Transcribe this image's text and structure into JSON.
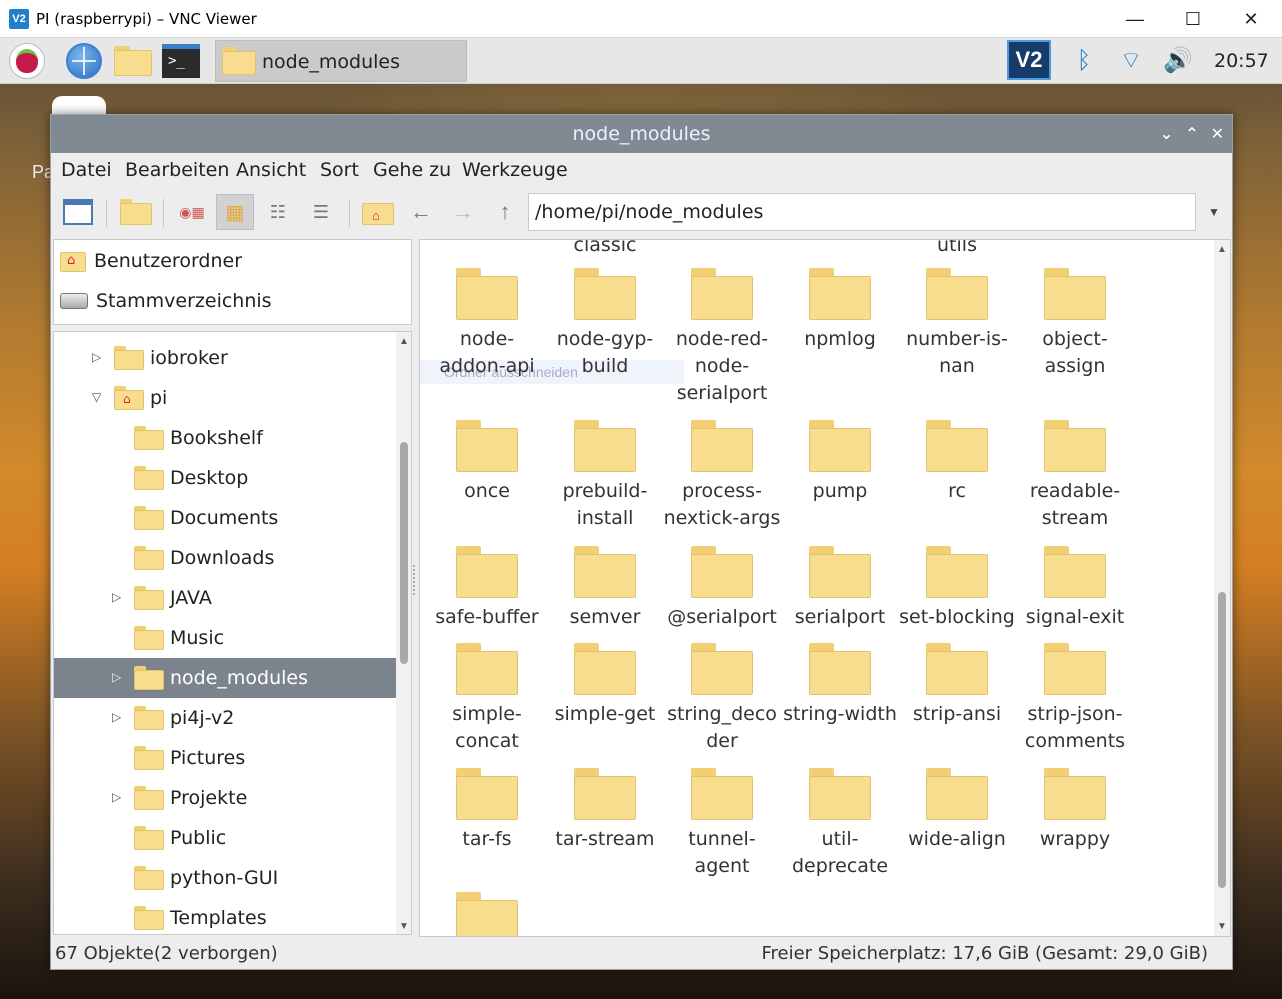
{
  "vnc": {
    "logo": "V2",
    "title": "PI (raspberrypi) – VNC Viewer",
    "minimize": "—",
    "maximize": "☐",
    "close": "✕"
  },
  "desktop": {
    "label": "Pa"
  },
  "taskbar": {
    "task_label": "node_modules",
    "tray_vnc": "V2",
    "clock": "20:57"
  },
  "window": {
    "title": "node_modules",
    "btn_min": "⌄",
    "btn_max": "⌃",
    "btn_close": "✕"
  },
  "menu": [
    "Datei",
    "Bearbeiten",
    "Ansicht",
    "Sort",
    "Gehe zu",
    "Werkzeuge"
  ],
  "toolbar": {
    "path": "/home/pi/node_modules"
  },
  "places": [
    {
      "label": "Benutzerordner",
      "icon": "home-icon"
    },
    {
      "label": "Stammverzeichnis",
      "icon": "drive-icon"
    }
  ],
  "tree": [
    {
      "label": "iobroker",
      "arrow": "▷",
      "level": 1
    },
    {
      "label": "pi",
      "arrow": "▽",
      "level": 1,
      "home": true
    },
    {
      "label": "Bookshelf",
      "arrow": "",
      "level": 2
    },
    {
      "label": "Desktop",
      "arrow": "",
      "level": 2
    },
    {
      "label": "Documents",
      "arrow": "",
      "level": 2
    },
    {
      "label": "Downloads",
      "arrow": "",
      "level": 2
    },
    {
      "label": "JAVA",
      "arrow": "▷",
      "level": 2
    },
    {
      "label": "Music",
      "arrow": "",
      "level": 2
    },
    {
      "label": "node_modules",
      "arrow": "▷",
      "level": 2,
      "selected": true
    },
    {
      "label": "pi4j-v2",
      "arrow": "▷",
      "level": 2
    },
    {
      "label": "Pictures",
      "arrow": "",
      "level": 2
    },
    {
      "label": "Projekte",
      "arrow": "▷",
      "level": 2
    },
    {
      "label": "Public",
      "arrow": "",
      "level": 2
    },
    {
      "label": "python-GUI",
      "arrow": "",
      "level": 2
    },
    {
      "label": "Templates",
      "arrow": "",
      "level": 2
    }
  ],
  "main": {
    "partial_top": [
      "classic",
      "utils"
    ],
    "cut_hint": "Ordner ausschneiden",
    "rows": [
      [
        "node-\naddon-api",
        "node-gyp-\nbuild",
        "node-red-\nnode-\nserialport",
        "npmlog",
        "number-is-\nnan",
        "object-\nassign"
      ],
      [
        "once",
        "prebuild-\ninstall",
        "process-\nnextick-args",
        "pump",
        "rc",
        "readable-\nstream"
      ],
      [
        "safe-buffer",
        "semver",
        "@serialport",
        "serialport",
        "set-blocking",
        "signal-exit"
      ],
      [
        "simple-\nconcat",
        "simple-get",
        "string_deco\nder",
        "string-width",
        "strip-ansi",
        "strip-json-\ncomments"
      ],
      [
        "tar-fs",
        "tar-stream",
        "tunnel-\nagent",
        "util-\ndeprecate",
        "wide-align",
        "wrappy"
      ]
    ]
  },
  "status": {
    "left": "67 Objekte(2 verborgen)",
    "right": "Freier Speicherplatz: 17,6 GiB (Gesamt: 29,0 GiB)"
  }
}
